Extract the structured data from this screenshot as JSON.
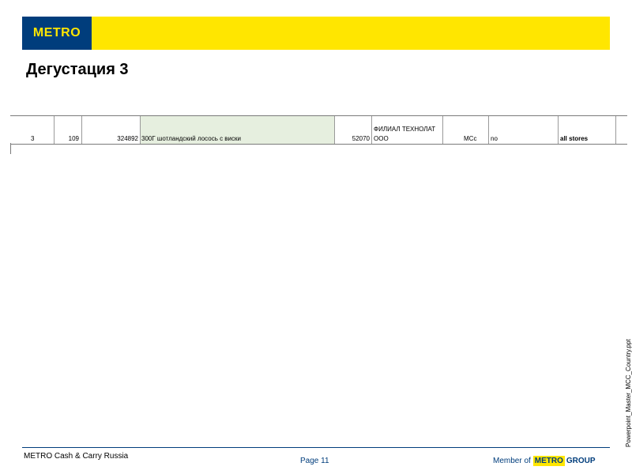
{
  "header": {
    "logo_text": "METRO",
    "band_color": "#ffe600",
    "logo_color": "#003d7c"
  },
  "title": "Дегустация 3",
  "table": {
    "row": {
      "num": "3",
      "dept": "109",
      "article": "324892",
      "description": "300Г шотландский лосось с виски",
      "supplier_code": "52070",
      "supplier_line1": "ФИЛИАЛ ТЕХНОЛАТ",
      "supplier_line2": "ООО",
      "format": "MCc",
      "flag": "no",
      "stores": "all stores"
    }
  },
  "side_note": "Powerpoint_Master_MCC_Country.ppt",
  "footer": {
    "company": "METRO Cash & Carry Russia",
    "page": "Page 11",
    "member_label": "Member of",
    "group_logo_metro": "METRO",
    "group_logo_word": "GROUP"
  }
}
